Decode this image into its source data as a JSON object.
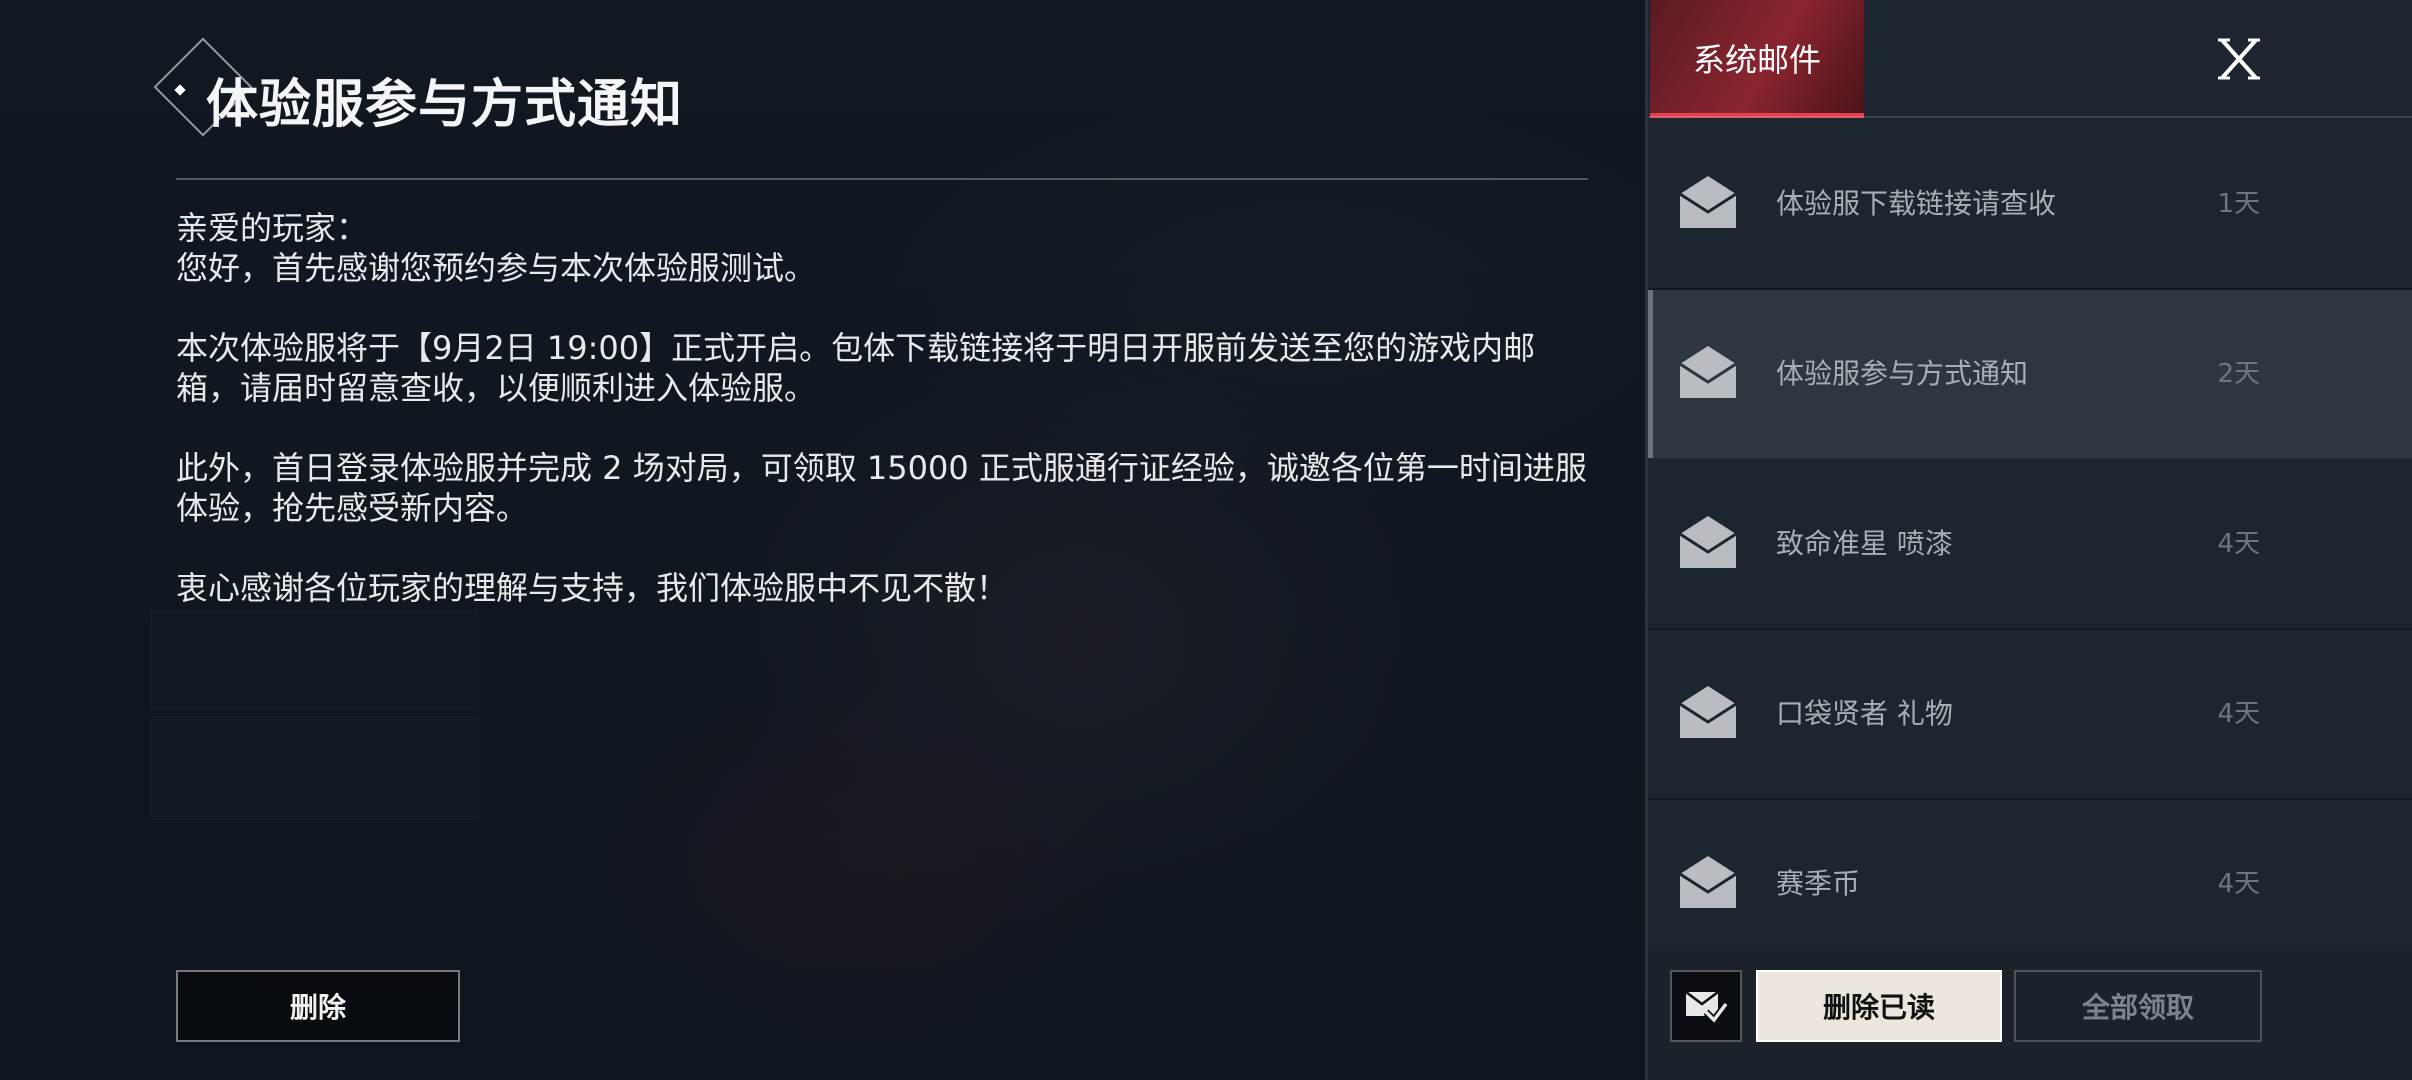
{
  "mail_detail": {
    "title": "体验服参与方式通知",
    "paragraphs": [
      "亲爱的玩家：",
      "您好，首先感谢您预约参与本次体验服测试。",
      "",
      "本次体验服将于【9月2日 19:00】正式开启。包体下载链接将于明日开服前发送至您的游戏内邮箱，请届时留意查收，以便顺利进入体验服。",
      "",
      "此外，首日登录体验服并完成 2 场对局，可领取 15000 正式服通行证经验，诚邀各位第一时间进服体验，抢先感受新内容。",
      "",
      "衷心感谢各位玩家的理解与支持，我们体验服中不见不散！"
    ],
    "delete_label": "删除"
  },
  "panel": {
    "tab_label": "系统邮件",
    "close_icon": "close-icon",
    "accent_color": "#e0424f"
  },
  "mails": [
    {
      "subject": "体验服下载链接请查收",
      "age": "1天",
      "selected": false
    },
    {
      "subject": "体验服参与方式通知",
      "age": "2天",
      "selected": true
    },
    {
      "subject": "致命准星 喷漆",
      "age": "4天",
      "selected": false
    },
    {
      "subject": "口袋贤者 礼物",
      "age": "4天",
      "selected": false
    },
    {
      "subject": "赛季币",
      "age": "4天",
      "selected": false
    }
  ],
  "footer": {
    "delete_read_label": "删除已读",
    "claim_all_label": "全部领取"
  }
}
